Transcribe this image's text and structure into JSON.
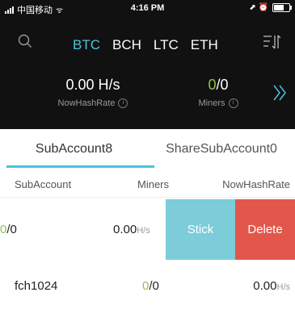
{
  "statusbar": {
    "carrier": "中国移动",
    "wifi": "ᯤ",
    "time": "4:16 PM",
    "extra": "⬈ ⏰"
  },
  "coin_tabs": [
    {
      "label": "BTC",
      "active": true
    },
    {
      "label": "BCH",
      "active": false
    },
    {
      "label": "LTC",
      "active": false
    },
    {
      "label": "ETH",
      "active": false
    }
  ],
  "stats": {
    "hashrate_value": "0.00 H/s",
    "hashrate_label": "NowHashRate",
    "miners_online": "0",
    "miners_total": "/0",
    "miners_label": "Miners",
    "info_icon": "i"
  },
  "subtabs": [
    "SubAccount8",
    "ShareSubAccount0"
  ],
  "table": {
    "headers": [
      "SubAccount",
      "Miners",
      "NowHashRate"
    ],
    "rows": [
      {
        "name_online": "0",
        "name_total": "/0",
        "hashrate": "0.00",
        "unit": "H/s"
      },
      {
        "name": "fch1024",
        "miners_online": "0",
        "miners_total": "/0",
        "hashrate": "0.00",
        "unit": "H/s"
      }
    ]
  },
  "actions": {
    "stick": "Stick",
    "delete": "Delete"
  },
  "colors": {
    "accent": "#4cc3da",
    "green": "#8fc34a",
    "stick_bg": "#7cccd9",
    "delete_bg": "#e2574b",
    "header_bg": "#111111"
  },
  "icons": [
    "search-icon",
    "sort-icon",
    "chevron-right-icon",
    "info-icon",
    "signal-icon",
    "wifi-icon",
    "battery-icon"
  ]
}
